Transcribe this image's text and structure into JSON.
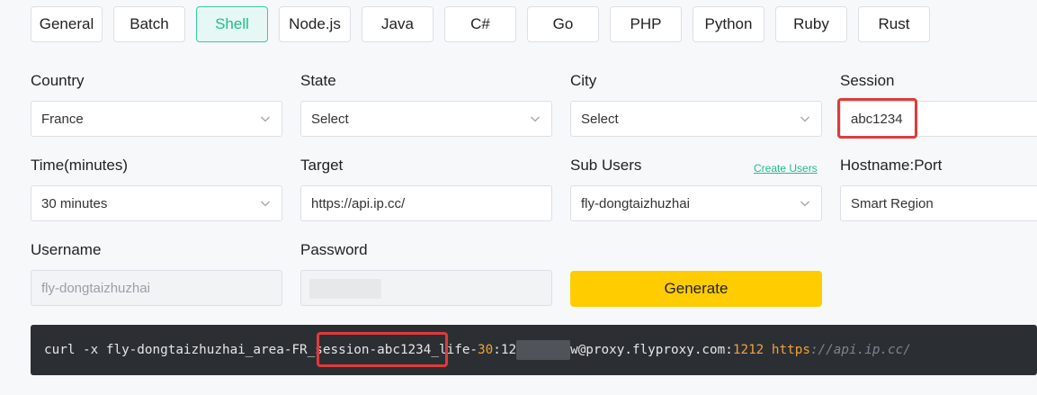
{
  "tabs": [
    "General",
    "Batch",
    "Shell",
    "Node.js",
    "Java",
    "C#",
    "Go",
    "PHP",
    "Python",
    "Ruby",
    "Rust"
  ],
  "active_tab": "Shell",
  "form": {
    "country": {
      "label": "Country",
      "value": "France"
    },
    "state": {
      "label": "State",
      "value": "Select"
    },
    "city": {
      "label": "City",
      "value": "Select"
    },
    "session": {
      "label": "Session",
      "value": "abc1234"
    },
    "time": {
      "label": "Time(minutes)",
      "value": "30 minutes"
    },
    "target": {
      "label": "Target",
      "value": "https://api.ip.cc/"
    },
    "sub_users": {
      "label": "Sub Users",
      "value": "fly-dongtaizhuzhai",
      "link": "Create Users"
    },
    "hostname_port": {
      "label": "Hostname:Port",
      "value": "Smart Region"
    },
    "username": {
      "label": "Username",
      "value": "fly-dongtaizhuzhai"
    },
    "password": {
      "label": "Password",
      "value": ""
    },
    "generate_label": "Generate"
  },
  "command": {
    "prefix": "curl -x fly-dongtaizhuzhai_area-FR_",
    "session_part": "session-abc1234",
    "life_part": "_life-",
    "life_value": "30",
    "sep": ":12",
    "after_mask": "w@proxy.flyproxy.com:",
    "port": "1212",
    "scheme": "https",
    "url_rest": "://api.ip.cc/"
  },
  "colors": {
    "accent": "#22bd90",
    "button": "#ffcc00",
    "highlight": "#e03a3a",
    "command_bg": "#2b2f33",
    "command_number": "#f0a23a"
  }
}
